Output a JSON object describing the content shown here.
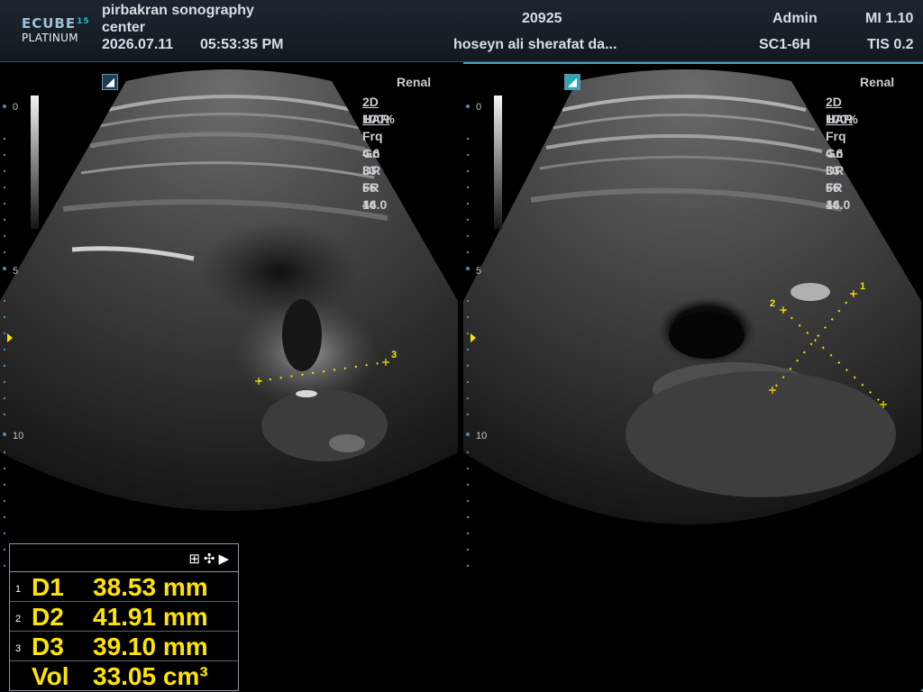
{
  "header": {
    "logo_line1": "ECUBE",
    "logo_num": "15",
    "logo_line2": "PLATINUM",
    "institution_line1": "pirbakran sonography",
    "institution_line2": "center",
    "date": "2026.07.11",
    "time": "05:53:35  PM",
    "patient_id": "20925",
    "patient_name": "hoseyn ali sherafat da...",
    "operator": "Admin",
    "probe": "SC1-6H",
    "mi": "MI 1.10",
    "tis": "TIS 0.2"
  },
  "left_pane": {
    "preset": "Renal",
    "mode": "2D HAR",
    "power": "100%",
    "freq": "Frq 4.6",
    "gain": "Gn 33",
    "dr": "DR 66",
    "fr": "FR 46",
    "depth": "14.0",
    "depth_marks": [
      "0",
      "5",
      "10"
    ],
    "caliper_label": "3"
  },
  "right_pane": {
    "preset": "Renal",
    "mode": "2D HAR",
    "power": "100%",
    "freq": "Frq 4.6",
    "gain": "Gn 33",
    "dr": "DR 66",
    "fr": "FR 46",
    "depth": "14.0",
    "depth_marks": [
      "0",
      "5",
      "10"
    ],
    "caliper_labels": [
      "1",
      "2"
    ]
  },
  "measurements": {
    "tools": "⊞✣▶",
    "rows": [
      {
        "index": "1",
        "label": "D1",
        "value": "38.53 mm"
      },
      {
        "index": "2",
        "label": "D2",
        "value": "41.91 mm"
      },
      {
        "index": "3",
        "label": "D3",
        "value": "39.10 mm"
      },
      {
        "index": "",
        "label": "Vol",
        "value": "33.05 cm³"
      }
    ]
  },
  "colors": {
    "measurement_text": "#ffe400",
    "accent": "#3fa6c0"
  }
}
